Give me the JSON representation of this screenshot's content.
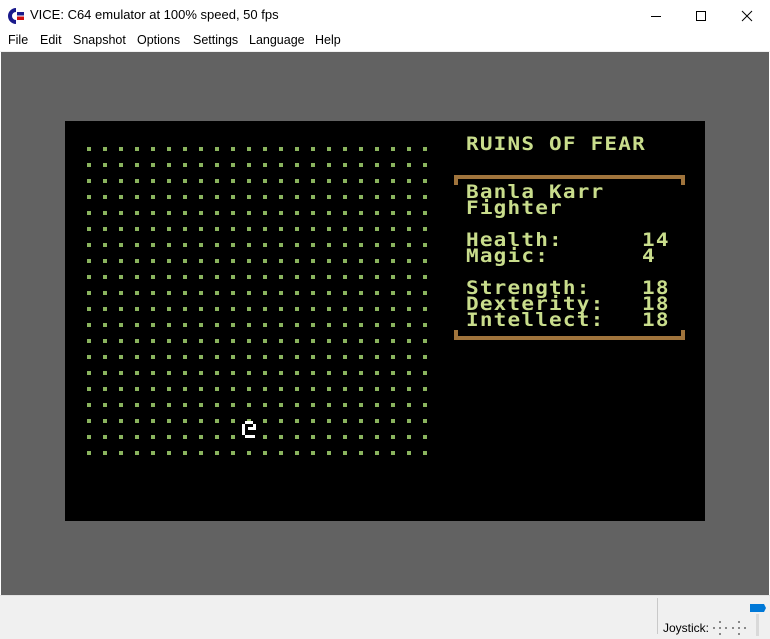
{
  "window": {
    "title": "VICE: C64 emulator at 100% speed, 50 fps",
    "icon": "commodore-logo-icon",
    "controls": [
      "minimize-icon",
      "maximize-icon",
      "close-icon"
    ]
  },
  "menu": {
    "items": [
      {
        "label": "File"
      },
      {
        "label": "Edit"
      },
      {
        "label": "Snapshot"
      },
      {
        "label": "Options"
      },
      {
        "label": "Settings"
      },
      {
        "label": "Language"
      },
      {
        "label": "Help"
      }
    ]
  },
  "game": {
    "title": "RUINS OF FEAR",
    "character": {
      "name": "Banla Karr",
      "class": "Fighter"
    },
    "stats": [
      {
        "label": "Health:",
        "value": "14"
      },
      {
        "label": "Magic:",
        "value": "4"
      },
      {
        "label": "Strength:",
        "value": "18"
      },
      {
        "label": "Dexterity:",
        "value": "18"
      },
      {
        "label": "Intellect:",
        "value": "18"
      }
    ],
    "map": {
      "columns": 22,
      "rows": 20,
      "player_position": {
        "col": 10,
        "row": 18
      }
    },
    "colors": {
      "screen": "#000000",
      "border": "#626262",
      "text": "#c9dd8c",
      "floor_dot": "#8ab45e",
      "frame": "#a0743c",
      "player": "#ffffff"
    }
  },
  "status": {
    "joystick_label": "Joystick:"
  }
}
